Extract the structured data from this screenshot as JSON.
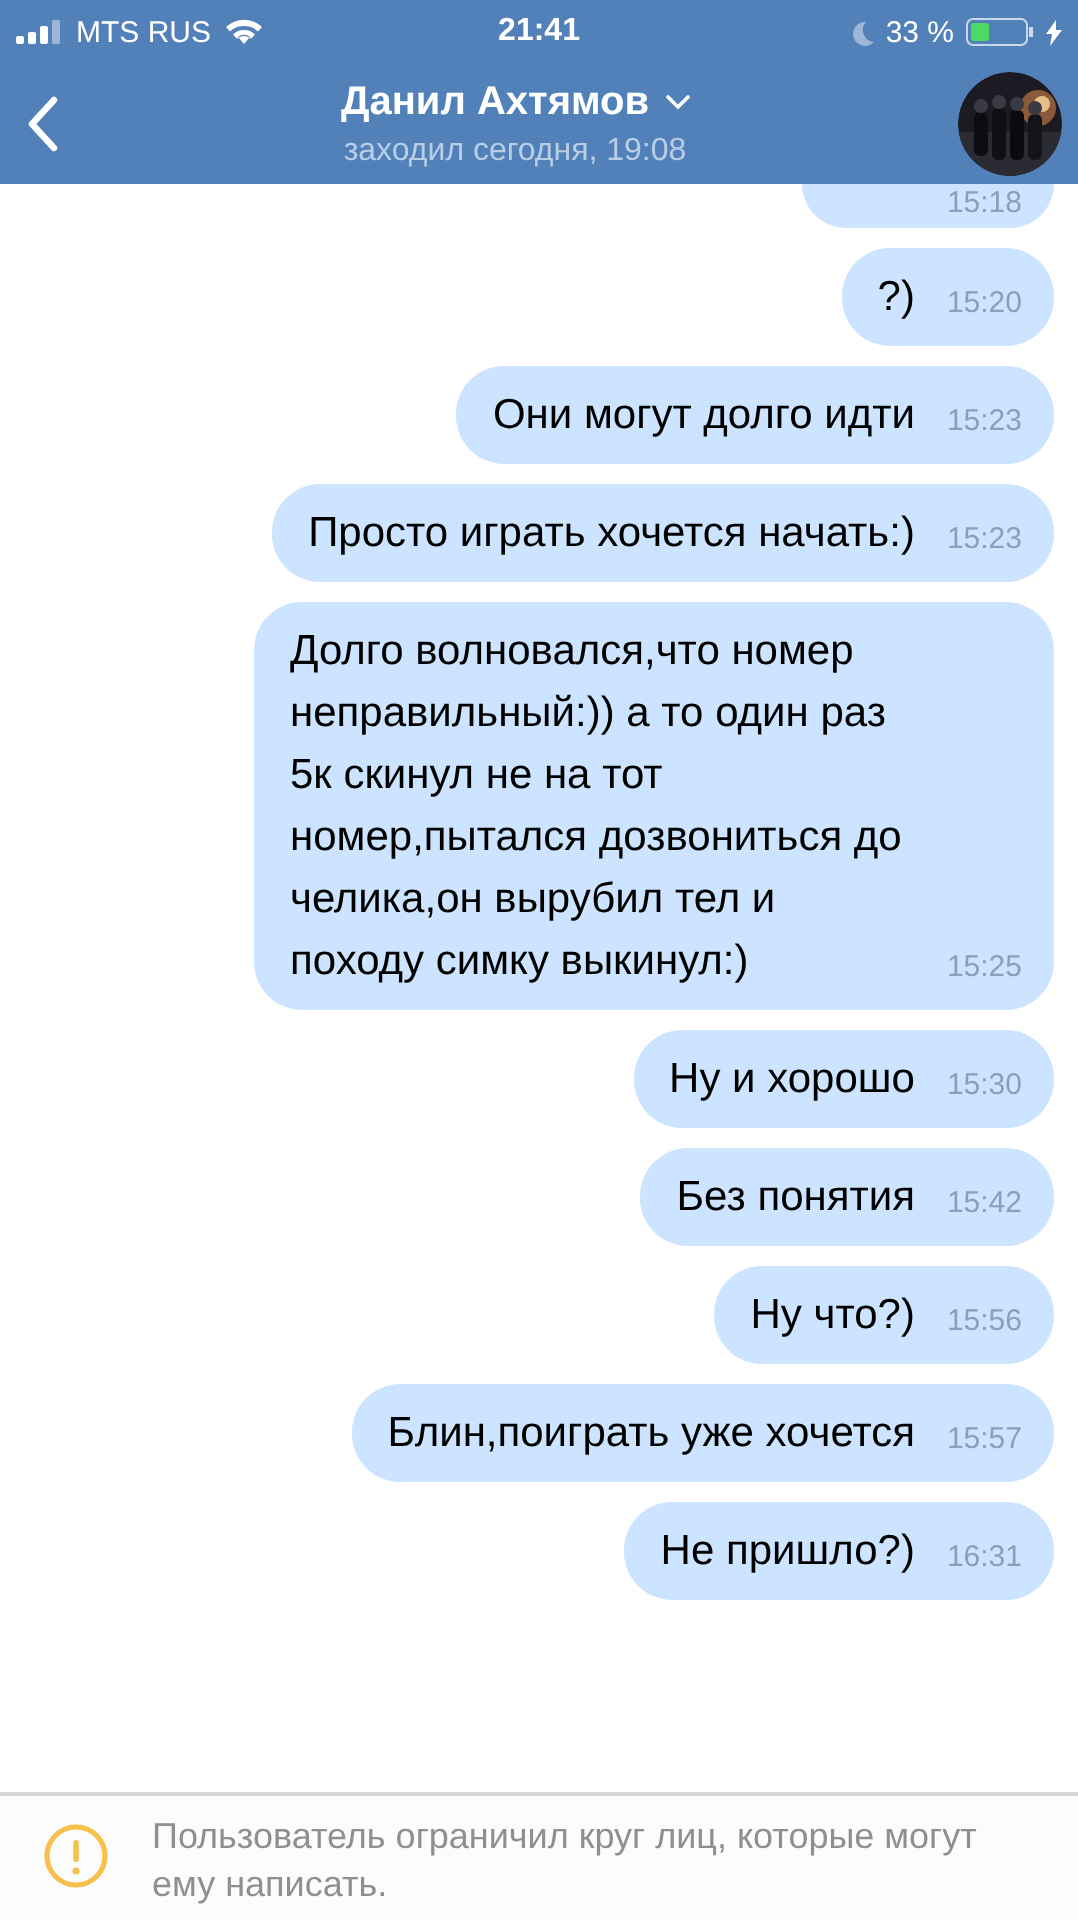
{
  "status_bar": {
    "carrier": "MTS RUS",
    "time": "21:41",
    "battery": "33 %"
  },
  "header": {
    "title": "Данил Ахтямов",
    "subtitle": "заходил сегодня, 19:08"
  },
  "messages": [
    {
      "time": "15:18",
      "cut": true
    },
    {
      "text": "?)",
      "time": "15:20",
      "cut": false
    },
    {
      "text": "Они могут долго идти",
      "time": "15:23",
      "cut": false
    },
    {
      "text": "Просто играть хочется начать:)",
      "time": "15:23",
      "cut": false
    },
    {
      "text": "Долго волновался,что номер неправильный:)) а то один раз 5к скинул не на тот номер,пытался дозвониться до челика,он вырубил тел и походу симку выкинул:)",
      "time": "15:25",
      "cut": false
    },
    {
      "text": "Ну и хорошо",
      "time": "15:30",
      "cut": false
    },
    {
      "text": "Без понятия",
      "time": "15:42",
      "cut": false
    },
    {
      "text": "Ну что?)",
      "time": "15:56",
      "cut": false
    },
    {
      "text": "Блин,поиграть уже хочется",
      "time": "15:57",
      "cut": false
    },
    {
      "text": "Не пришло?)",
      "time": "16:31",
      "cut": false
    }
  ],
  "notice": {
    "text": "Пользователь ограничил круг лиц, которые могут ему написать."
  }
}
